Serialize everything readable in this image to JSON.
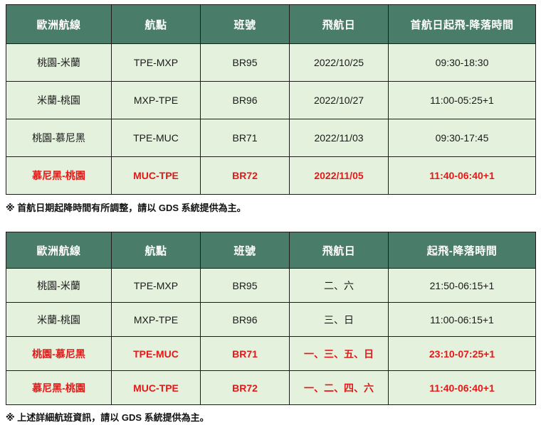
{
  "tables": [
    {
      "headers": [
        "歐洲航線",
        "航點",
        "班號",
        "飛航日",
        "首航日起飛-降落時間"
      ],
      "rows": [
        {
          "route": "桃園-米蘭",
          "code": "TPE-MXP",
          "flight": "BR95",
          "date": "2022/10/25",
          "time": "09:30-18:30",
          "highlight": false
        },
        {
          "route": "米蘭-桃園",
          "code": "MXP-TPE",
          "flight": "BR96",
          "date": "2022/10/27",
          "time": "11:00-05:25+1",
          "highlight": false
        },
        {
          "route": "桃園-慕尼黑",
          "code": "TPE-MUC",
          "flight": "BR71",
          "date": "2022/11/03",
          "time": "09:30-17:45",
          "highlight": false
        },
        {
          "route": "慕尼黑-桃園",
          "code": "MUC-TPE",
          "flight": "BR72",
          "date": "2022/11/05",
          "time": "11:40-06:40+1",
          "highlight": true
        }
      ],
      "note": "※ 首航日期起降時間有所調整，請以 GDS 系統提供為主。"
    },
    {
      "headers": [
        "歐洲航線",
        "航點",
        "班號",
        "飛航日",
        "起飛-降落時間"
      ],
      "rows": [
        {
          "route": "桃園-米蘭",
          "code": "TPE-MXP",
          "flight": "BR95",
          "date": "二、六",
          "time": "21:50-06:15+1",
          "highlight": false
        },
        {
          "route": "米蘭-桃園",
          "code": "MXP-TPE",
          "flight": "BR96",
          "date": "三、日",
          "time": "11:00-06:15+1",
          "highlight": false
        },
        {
          "route": "桃園-慕尼黑",
          "code": "TPE-MUC",
          "flight": "BR71",
          "date": "一、三、五、日",
          "time": "23:10-07:25+1",
          "highlight": true
        },
        {
          "route": "慕尼黑-桃園",
          "code": "MUC-TPE",
          "flight": "BR72",
          "date": "一、二、四、六",
          "time": "11:40-06:40+1",
          "highlight": true
        }
      ],
      "note": "※ 上述詳細航班資訊，請以 GDS 系統提供為主。"
    }
  ],
  "colors": {
    "header_bg": "#4a7c6a",
    "header_text": "#ffffff",
    "cell_bg": "#e4f1dd",
    "highlight_text": "#e31919",
    "border": "#1c1c1c"
  }
}
